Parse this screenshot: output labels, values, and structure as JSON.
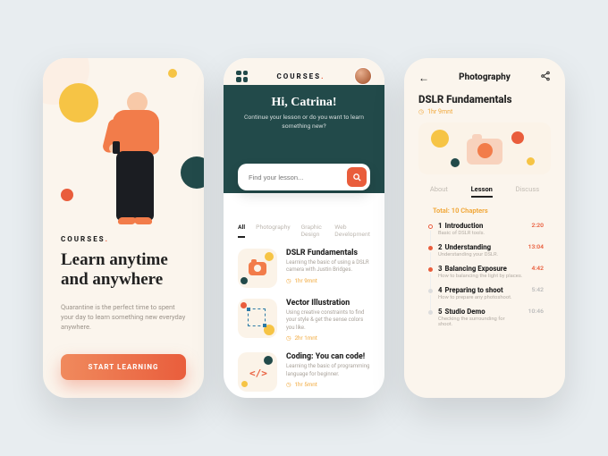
{
  "brand": "COURSES",
  "screen1": {
    "title_l1": "Learn anytime",
    "title_l2": "and anywhere",
    "desc": "Quarantine is the perfect time to spent your day to learn something new everyday anywhere.",
    "cta": "START LEARNING"
  },
  "screen2": {
    "header_label": "COURSES",
    "greeting": "Hi, Catrina!",
    "subtext": "Continue your lesson or do you want to learn something new?",
    "search_placeholder": "Find your lesson...",
    "tabs": [
      "All",
      "Photography",
      "Graphic Design",
      "Web Development"
    ],
    "courses": [
      {
        "title": "DSLR Fundamentals",
        "desc": "Learning the basic of using a DSLR camera with Justin Bridges.",
        "time": "1hr 9mnt"
      },
      {
        "title": "Vector Illustration",
        "desc": "Using creative constraints to find your style & get the sense colors you like.",
        "time": "2hr 1mnt"
      },
      {
        "title": "Coding: You can code!",
        "desc": "Learning the basic of programming language for beginner.",
        "time": "1hr 5mnt"
      }
    ]
  },
  "screen3": {
    "page_title": "Photography",
    "hero_title": "DSLR Fundamentals",
    "hero_time": "1hr 9mnt",
    "tabs": [
      "About",
      "Lesson",
      "Discuss"
    ],
    "total": "Total: 10 Chapters",
    "chapters": [
      {
        "n": "1",
        "title": "Introduction",
        "desc": "Basic of DSLR tools.",
        "dur": "2:20"
      },
      {
        "n": "2",
        "title": "Understanding",
        "desc": "Understanding your DSLR.",
        "dur": "13:04"
      },
      {
        "n": "3",
        "title": "Balancing Exposure",
        "desc": "How to balancing the light by places.",
        "dur": "4:42"
      },
      {
        "n": "4",
        "title": "Preparing to shoot",
        "desc": "How to prepare any photoshoot.",
        "dur": "5:42"
      },
      {
        "n": "5",
        "title": "Studio Demo",
        "desc": "Checking the surrounding for shoot.",
        "dur": "10:46"
      }
    ]
  },
  "colors": {
    "accent": "#e95d3c",
    "dark_teal": "#224a4a",
    "yellow": "#f6c445"
  }
}
